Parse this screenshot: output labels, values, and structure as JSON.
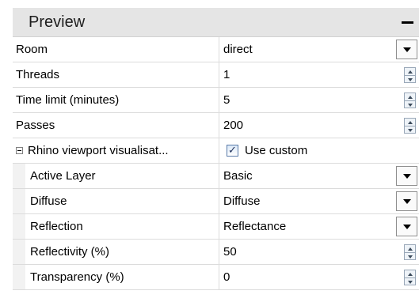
{
  "panel": {
    "title": "Preview"
  },
  "rows": [
    {
      "label": "Room",
      "value": "direct",
      "control": "dropdown"
    },
    {
      "label": "Threads",
      "value": "1",
      "control": "spinner"
    },
    {
      "label": "Time limit (minutes)",
      "value": "5",
      "control": "spinner"
    },
    {
      "label": "Passes",
      "value": "200",
      "control": "spinner"
    }
  ],
  "group": {
    "label": "Rhino viewport visualisat...",
    "checkbox_label": "Use custom",
    "checked": true
  },
  "children": [
    {
      "label": "Active Layer",
      "value": "Basic",
      "control": "dropdown"
    },
    {
      "label": "Diffuse",
      "value": "Diffuse",
      "control": "dropdown"
    },
    {
      "label": "Reflection",
      "value": "Reflectance",
      "control": "dropdown"
    },
    {
      "label": "Reflectivity (%)",
      "value": "50",
      "control": "spinner"
    },
    {
      "label": "Transparency (%)",
      "value": "0",
      "control": "spinner"
    }
  ],
  "icons": {
    "collapse": "minus-icon",
    "dropdown": "dropdown-arrow-icon",
    "spinner": "spinner-arrows-icon",
    "expander": "tree-collapse-icon",
    "checkmark": "checkmark-icon"
  },
  "colors": {
    "header_bg": "#e5e5e5",
    "grid_line": "#dcdcdc",
    "indent_bg": "#f2f2f2"
  }
}
